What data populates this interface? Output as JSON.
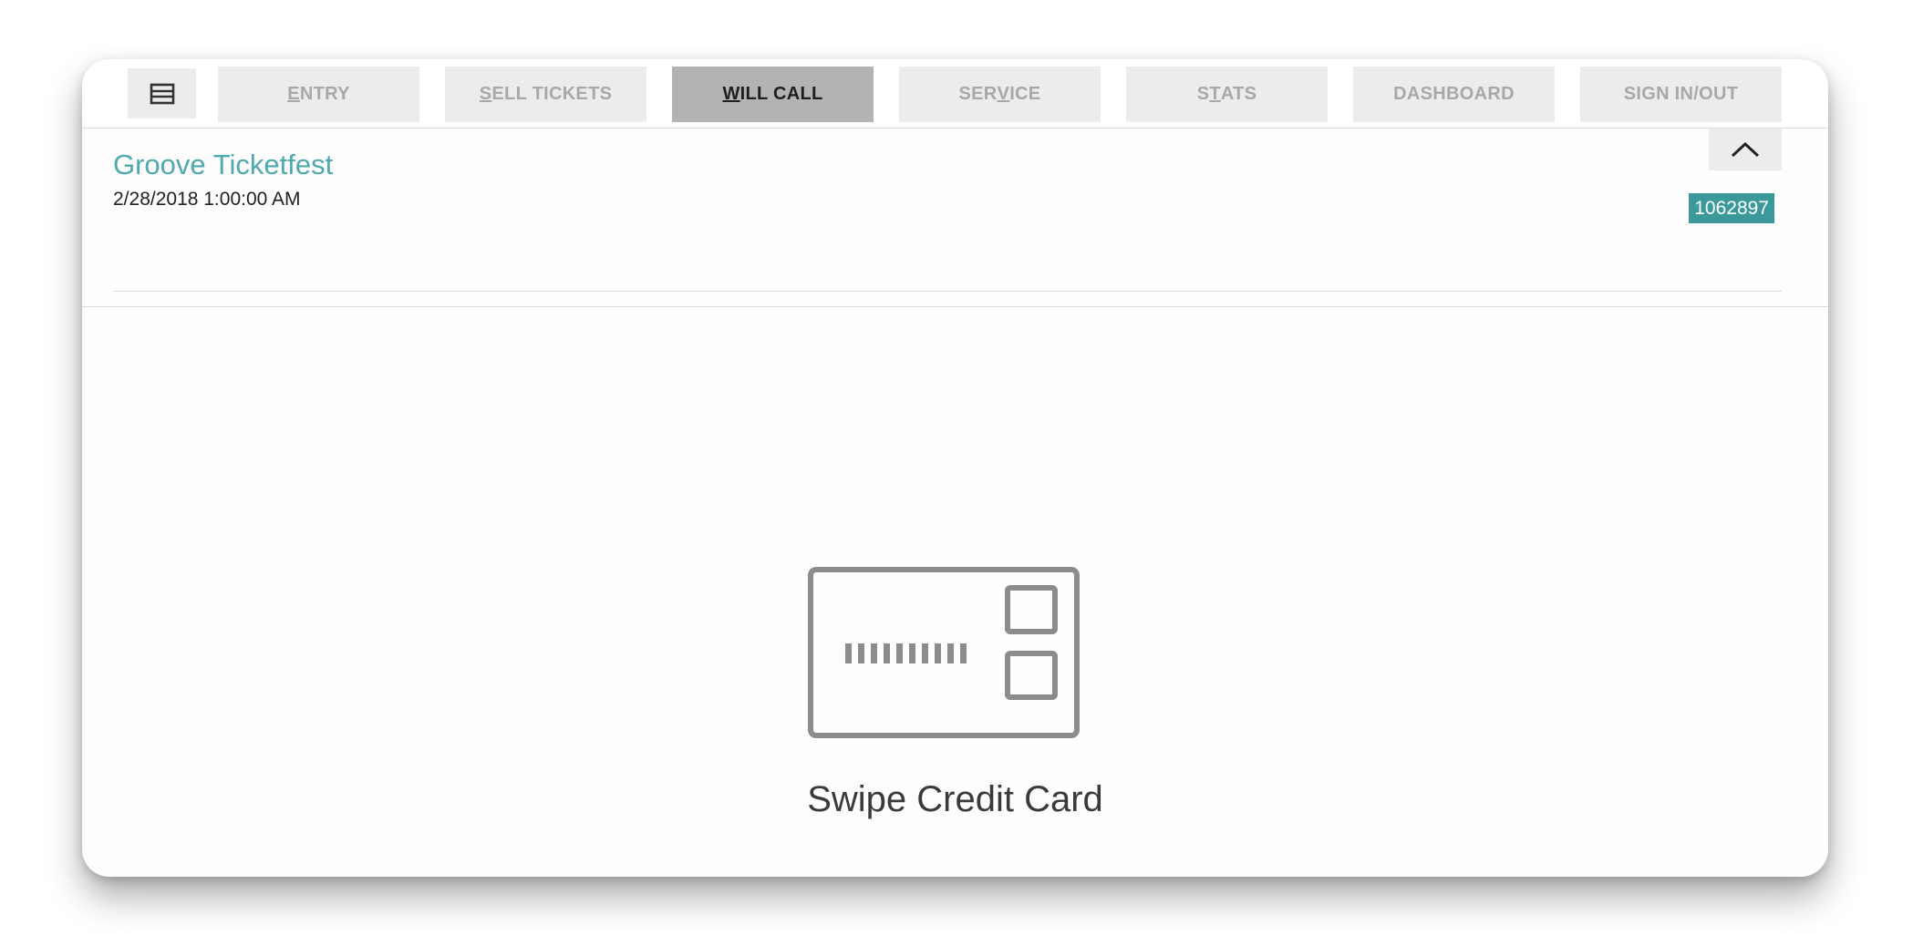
{
  "menu_icon": "list-menu-icon",
  "tabs": [
    {
      "pre": "",
      "key": "E",
      "post": "NTRY",
      "active": false
    },
    {
      "pre": "",
      "key": "S",
      "post": "ELL TICKETS",
      "active": false
    },
    {
      "pre": "",
      "key": "W",
      "post": "ILL CALL",
      "active": true
    },
    {
      "pre": "SER",
      "key": "V",
      "post": "ICE",
      "active": false
    },
    {
      "pre": "S",
      "key": "T",
      "post": "ATS",
      "active": false
    },
    {
      "pre": "DASHBOARD",
      "key": "",
      "post": "",
      "active": false
    },
    {
      "pre": "SIGN IN/OUT",
      "key": "",
      "post": "",
      "active": false
    }
  ],
  "collapse_icon": "chevron-up-icon",
  "event": {
    "name": "Groove Ticketfest",
    "date": "2/28/2018 1:00:00 AM",
    "id": "1062897"
  },
  "prompt": {
    "icon": "credit-card-icon",
    "text": "Swipe Credit Card"
  },
  "colors": {
    "accent": "#4fa9ad",
    "badge": "#3b999b",
    "active_tab": "#b3b3b3",
    "inactive_tab": "#ececec"
  }
}
